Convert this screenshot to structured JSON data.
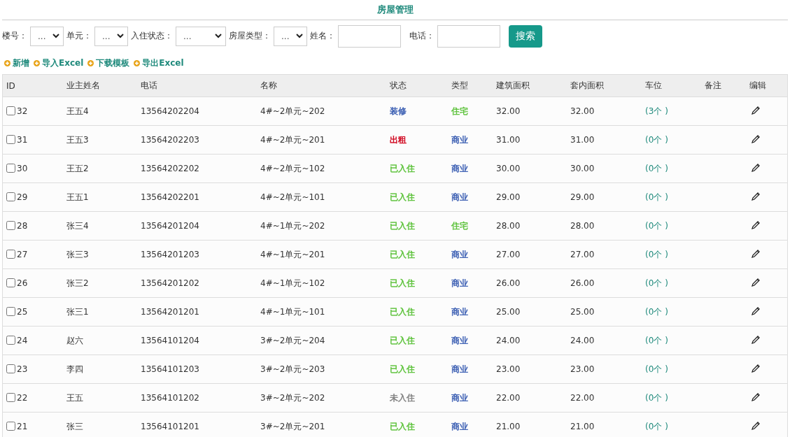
{
  "title": "房屋管理",
  "filters": [
    {
      "label": "楼号：",
      "kind": "select",
      "value": "..."
    },
    {
      "label": "单元：",
      "kind": "select",
      "value": "..."
    },
    {
      "label": "入住状态：",
      "kind": "select",
      "value": "..."
    },
    {
      "label": "房屋类型：",
      "kind": "select",
      "value": "..."
    },
    {
      "label": "姓名：",
      "kind": "input"
    },
    {
      "label": "电话：",
      "kind": "input"
    }
  ],
  "search_button": "搜索",
  "actions": [
    "新增",
    "导入Excel",
    "下载模板",
    "导出Excel"
  ],
  "table": {
    "columns": [
      "ID",
      "业主姓名",
      "电话",
      "名称",
      "状态",
      "类型",
      "建筑面积",
      "套内面积",
      "车位",
      "备注",
      "编辑"
    ],
    "rows": [
      {
        "id": "32",
        "checked": false,
        "owner": "王五4",
        "phone": "13564202204",
        "name": "4#~2单元~202",
        "status": {
          "text": "装修",
          "color": "#3c5fb3"
        },
        "type": {
          "text": "住宅",
          "color": "#5cc23a"
        },
        "area": "32.00",
        "inner_area": "32.00",
        "parking": "(3个 )"
      },
      {
        "id": "31",
        "checked": false,
        "owner": "王五3",
        "phone": "13564202203",
        "name": "4#~2单元~201",
        "status": {
          "text": "出租",
          "color": "#d0021b"
        },
        "type": {
          "text": "商业",
          "color": "#3c5fb3"
        },
        "area": "31.00",
        "inner_area": "31.00",
        "parking": "(0个 )"
      },
      {
        "id": "30",
        "checked": false,
        "owner": "王五2",
        "phone": "13564202202",
        "name": "4#~2单元~102",
        "status": {
          "text": "已入住",
          "color": "#5cc23a"
        },
        "type": {
          "text": "商业",
          "color": "#3c5fb3"
        },
        "area": "30.00",
        "inner_area": "30.00",
        "parking": "(0个 )"
      },
      {
        "id": "29",
        "checked": false,
        "owner": "王五1",
        "phone": "13564202201",
        "name": "4#~2单元~101",
        "status": {
          "text": "已入住",
          "color": "#5cc23a"
        },
        "type": {
          "text": "商业",
          "color": "#3c5fb3"
        },
        "area": "29.00",
        "inner_area": "29.00",
        "parking": "(0个 )"
      },
      {
        "id": "28",
        "checked": false,
        "owner": "张三4",
        "phone": "13564201204",
        "name": "4#~1单元~202",
        "status": {
          "text": "已入住",
          "color": "#5cc23a"
        },
        "type": {
          "text": "住宅",
          "color": "#5cc23a"
        },
        "area": "28.00",
        "inner_area": "28.00",
        "parking": "(0个 )"
      },
      {
        "id": "27",
        "checked": false,
        "owner": "张三3",
        "phone": "13564201203",
        "name": "4#~1单元~201",
        "status": {
          "text": "已入住",
          "color": "#5cc23a"
        },
        "type": {
          "text": "商业",
          "color": "#3c5fb3"
        },
        "area": "27.00",
        "inner_area": "27.00",
        "parking": "(0个 )"
      },
      {
        "id": "26",
        "checked": false,
        "owner": "张三2",
        "phone": "13564201202",
        "name": "4#~1单元~102",
        "status": {
          "text": "已入住",
          "color": "#5cc23a"
        },
        "type": {
          "text": "商业",
          "color": "#3c5fb3"
        },
        "area": "26.00",
        "inner_area": "26.00",
        "parking": "(0个 )"
      },
      {
        "id": "25",
        "checked": false,
        "owner": "张三1",
        "phone": "13564201201",
        "name": "4#~1单元~101",
        "status": {
          "text": "已入住",
          "color": "#5cc23a"
        },
        "type": {
          "text": "商业",
          "color": "#3c5fb3"
        },
        "area": "25.00",
        "inner_area": "25.00",
        "parking": "(0个 )"
      },
      {
        "id": "24",
        "checked": false,
        "owner": "赵六",
        "phone": "13564101204",
        "name": "3#~2单元~204",
        "status": {
          "text": "已入住",
          "color": "#5cc23a"
        },
        "type": {
          "text": "商业",
          "color": "#3c5fb3"
        },
        "area": "24.00",
        "inner_area": "24.00",
        "parking": "(0个 )"
      },
      {
        "id": "23",
        "checked": false,
        "owner": "李四",
        "phone": "13564101203",
        "name": "3#~2单元~203",
        "status": {
          "text": "已入住",
          "color": "#5cc23a"
        },
        "type": {
          "text": "商业",
          "color": "#3c5fb3"
        },
        "area": "23.00",
        "inner_area": "23.00",
        "parking": "(0个 )"
      },
      {
        "id": "22",
        "checked": false,
        "owner": "王五",
        "phone": "13564101202",
        "name": "3#~2单元~202",
        "status": {
          "text": "未入住",
          "color": "#808080"
        },
        "type": {
          "text": "商业",
          "color": "#3c5fb3"
        },
        "area": "22.00",
        "inner_area": "22.00",
        "parking": "(0个 )"
      },
      {
        "id": "21",
        "checked": false,
        "owner": "张三",
        "phone": "13564101201",
        "name": "3#~2单元~201",
        "status": {
          "text": "已入住",
          "color": "#5cc23a"
        },
        "type": {
          "text": "商业",
          "color": "#3c5fb3"
        },
        "area": "21.00",
        "inner_area": "21.00",
        "parking": "(0个 )"
      }
    ]
  }
}
